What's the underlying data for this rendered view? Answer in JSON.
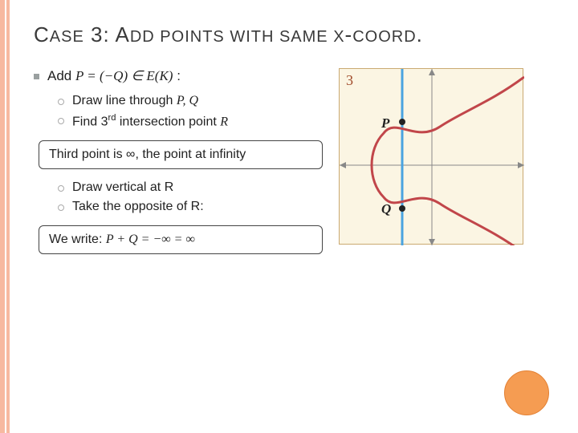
{
  "title_parts": {
    "a": "C",
    "b": "ASE",
    "c": " 3: A",
    "d": "DD POINTS WITH SAME X",
    "e": "-",
    "f": "COORD",
    "g": "."
  },
  "line_add": {
    "prefix": "Add ",
    "eq": "P = (−Q)  ∈ E(K)",
    "suffix": " :"
  },
  "sub1": {
    "text_a": "Draw line through ",
    "text_b": "P, Q"
  },
  "sub2": {
    "a": "Find 3",
    "b": "rd",
    "c": " intersection point ",
    "d": "R"
  },
  "box1": "Third point is ∞, the point at infinity",
  "sub3": "Draw vertical at R",
  "sub4": "Take the opposite of R:",
  "box2": {
    "a": "We write: ",
    "b": "P + Q = −∞ =  ∞"
  },
  "figure": {
    "num": "3",
    "P": "P",
    "Q": "Q"
  }
}
